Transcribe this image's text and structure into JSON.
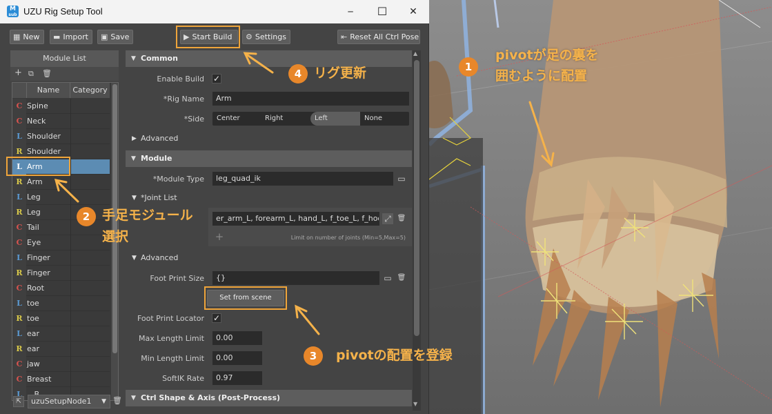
{
  "window": {
    "title": "UZU Rig Setup Tool",
    "app_icon_letter": "M",
    "app_icon_sub": "sub",
    "minimize": "─",
    "maximize": "☐",
    "close": "✕"
  },
  "toolbar": {
    "new_label": "New",
    "import_label": "Import",
    "save_label": "Save",
    "start_build_label": "Start Build",
    "settings_label": "Settings",
    "reset_label": "Reset All Ctrl Pose"
  },
  "module_list": {
    "title": "Module List",
    "col_name": "Name",
    "col_category": "Category",
    "rows": [
      {
        "side": "C",
        "name": "Spine"
      },
      {
        "side": "C",
        "name": "Neck"
      },
      {
        "side": "L",
        "name": "Shoulder"
      },
      {
        "side": "R",
        "name": "Shoulder"
      },
      {
        "side": "L",
        "name": "Arm"
      },
      {
        "side": "R",
        "name": "Arm"
      },
      {
        "side": "L",
        "name": "Leg"
      },
      {
        "side": "R",
        "name": "Leg"
      },
      {
        "side": "C",
        "name": "Tail"
      },
      {
        "side": "C",
        "name": "Eye"
      },
      {
        "side": "L",
        "name": "Finger"
      },
      {
        "side": "R",
        "name": "Finger"
      },
      {
        "side": "C",
        "name": "Root"
      },
      {
        "side": "L",
        "name": "toe"
      },
      {
        "side": "R",
        "name": "toe"
      },
      {
        "side": "L",
        "name": "ear"
      },
      {
        "side": "R",
        "name": "ear"
      },
      {
        "side": "C",
        "name": "jaw"
      },
      {
        "side": "C",
        "name": "Breast"
      },
      {
        "side": "L",
        "name": "...B..."
      }
    ],
    "selected_index": 4,
    "node_name": "uzuSetupNode1"
  },
  "side_colors": {
    "C": "#d9534f",
    "L": "#5b9bd5",
    "R": "#d9c94a"
  },
  "settings": {
    "common_title": "Common",
    "enable_build_label": "Enable Build",
    "rig_name_label": "*Rig Name",
    "rig_name_value": "Arm",
    "side_label": "*Side",
    "side_options": [
      "Center",
      "Right",
      "Left",
      "None"
    ],
    "side_selected": "Left",
    "advanced1_title": "Advanced",
    "module_title": "Module",
    "module_type_label": "*Module Type",
    "module_type_value": "leg_quad_ik",
    "joint_list_title": "*Joint List",
    "joint_list_value": "er_arm_L, forearm_L, hand_L, f_toe_L, f_hoof_L",
    "joint_limit_note": "Limit on number of joints (Min=5,Max=5)",
    "advanced2_title": "Advanced",
    "foot_print_size_label": "Foot Print Size",
    "foot_print_size_value": "{}",
    "set_from_scene_label": "Set from scene",
    "foot_print_locator_label": "Foot Print Locator",
    "max_length_label": "Max Length Limit",
    "max_length_value": "0.00",
    "min_length_label": "Min Length Limit",
    "min_length_value": "0.00",
    "softik_label": "SoftIK Rate",
    "softik_value": "0.97",
    "ctrl_shape_title": "Ctrl Shape & Axis (Post-Process)"
  },
  "annotations": {
    "a1_num": "1",
    "a1_line1": "pivotが足の裏を",
    "a1_line2": "囲むように配置",
    "a2_num": "2",
    "a2_line1": "手足モジュール",
    "a2_line2": "選択",
    "a3_num": "3",
    "a3_text": "pivotの配置を登録",
    "a4_num": "4",
    "a4_text": "リグ更新",
    "color": "#f5b24a"
  }
}
